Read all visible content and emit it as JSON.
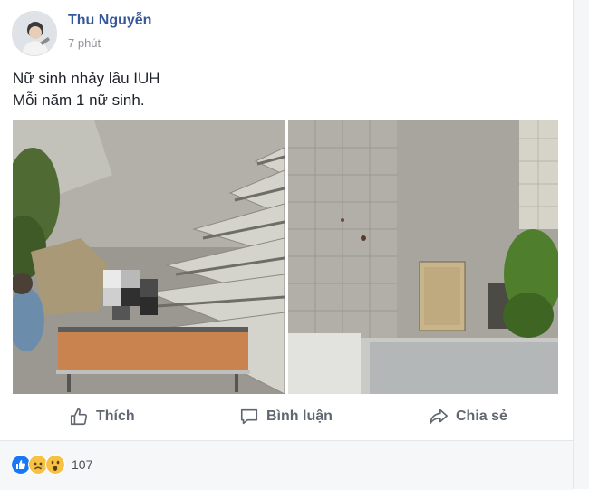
{
  "post": {
    "author": "Thu Nguyễn",
    "time": "7 phút",
    "text_line1": "Nữ sinh nhảy lầu IUH",
    "text_line2": "Mỗi năm 1 nữ sinh."
  },
  "actions": {
    "like": "Thích",
    "comment": "Bình luận",
    "share": "Chia sẻ"
  },
  "reactions": {
    "icons": [
      "like-icon",
      "sad-icon",
      "wow-icon"
    ],
    "count": "107"
  },
  "colors": {
    "author_link": "#365899",
    "muted": "#90949c",
    "action": "#606770",
    "like_blue": "#1877f2",
    "emoji_yellow": "#f7c244"
  }
}
